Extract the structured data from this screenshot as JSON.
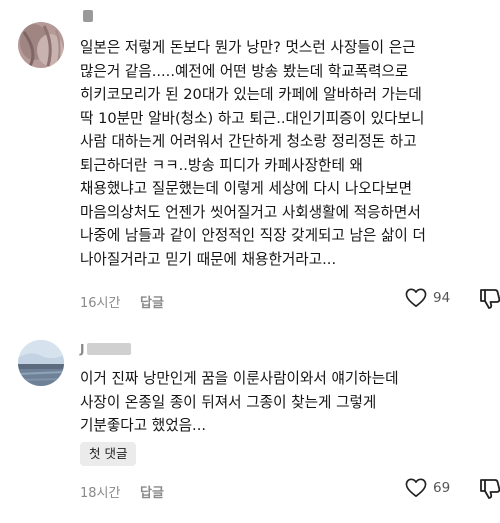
{
  "comments": [
    {
      "username_visible": "",
      "avatar": "avatar-icon",
      "text_lines": [
        "일본은 저렇게 돈보다 뭔가 낭만? 멋스런 사장들이 은근",
        "많은거 같음.....예전에 어떤 방송 봤는데 학교폭력으로",
        "히키코모리가 된 20대가 있는데 카페에 알바하러 가는데",
        "딱 10분만 알바(청소) 하고 퇴근..대인기피증이 있다보니",
        "사람 대하는게 어려워서 간단하게 청소랑 정리정돈 하고",
        "퇴근하더란 ㅋㅋ..방송 피디가 카페사장한테 왜",
        "채용했냐고 질문했는데 이렇게 세상에 다시 나오다보면",
        "마음의상처도 언젠가 씻어질거고 사회생활에 적응하면서",
        "나중에 남들과 같이 안정적인 직장 갖게되고 남은 삶이 더",
        "나아질거라고 믿기 때문에 채용한거라고..."
      ],
      "time": "16시간",
      "reply_label": "답글",
      "likes": "94",
      "like_icon": "heart-icon",
      "dislike_icon": "thumbs-down-icon"
    },
    {
      "username_visible": "J",
      "avatar": "avatar-icon",
      "text_lines": [
        "이거 진짜 낭만인게 꿈을 이룬사람이와서 얘기하는데",
        "사장이 온종일 종이 뒤져서 그종이 찾는게 그렇게",
        "기분좋다고 했었음..."
      ],
      "chip_label": "첫 댓글",
      "time": "18시간",
      "reply_label": "답글",
      "likes": "69",
      "like_icon": "heart-icon",
      "dislike_icon": "thumbs-down-icon"
    }
  ]
}
